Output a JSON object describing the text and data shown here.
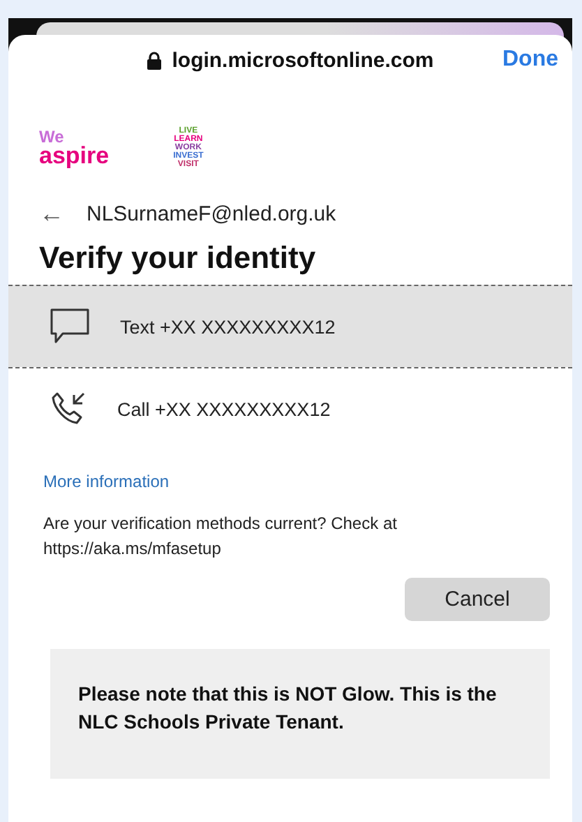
{
  "browser": {
    "address": "login.microsoftonline.com",
    "done": "Done"
  },
  "logos": [
    {
      "kind": "wordmark",
      "lines": [
        "We",
        "aspire"
      ]
    },
    {
      "kind": "stack",
      "lines": [
        "LIVE",
        "LEARN",
        "WORK",
        "INVEST",
        "VISIT"
      ]
    }
  ],
  "account": {
    "back": "←",
    "email": "NLSurnameF@nled.org.uk"
  },
  "title": "Verify your identity",
  "methods": [
    {
      "kind": "text",
      "label": "Text +XX XXXXXXXXX12",
      "selected": true
    },
    {
      "kind": "call",
      "label": "Call +XX XXXXXXXXX12",
      "selected": false
    }
  ],
  "more_link": "More information",
  "note": "Are your verification methods current? Check at https://aka.ms/mfasetup",
  "cancel": "Cancel",
  "banner": "Please note that this is NOT Glow. This is the NLC Schools Private Tenant."
}
